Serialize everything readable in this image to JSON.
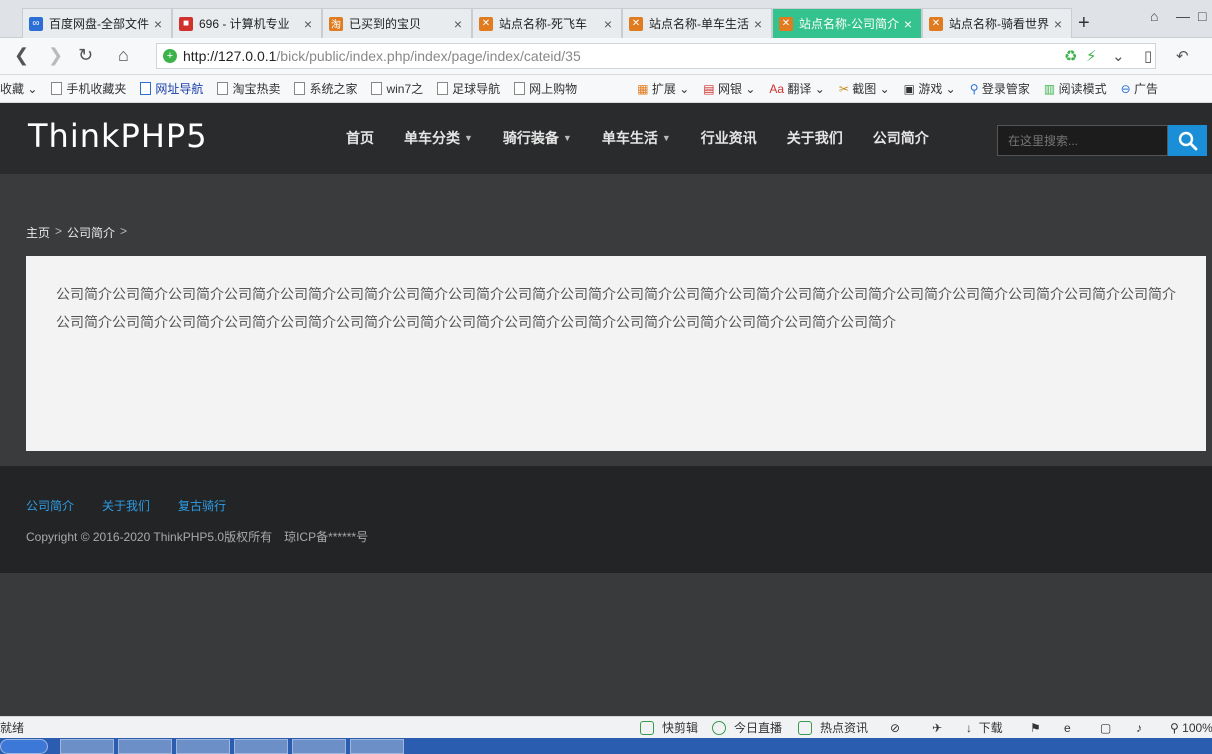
{
  "tabs": [
    {
      "title": "百度网盘-全部文件",
      "color": "#2b6fd6"
    },
    {
      "title": "696 - 计算机专业",
      "color": "#d0312d"
    },
    {
      "title": "已买到的宝贝",
      "color": "#e07b1f"
    },
    {
      "title": "站点名称-死飞车",
      "color": "#e07b1f"
    },
    {
      "title": "站点名称-单车生活",
      "color": "#e07b1f"
    },
    {
      "title": "站点名称-公司简介",
      "color": "#e07b1f",
      "active": true
    },
    {
      "title": "站点名称-骑看世界",
      "color": "#e07b1f"
    }
  ],
  "address": {
    "host": "http://127.0.0.1",
    "path": "/bick/public/index.php/index/page/index/cateid/35"
  },
  "bookmarks": {
    "b0": "收藏",
    "b1": "手机收藏夹",
    "b2": "网址导航",
    "b3": "淘宝热卖",
    "b4": "系统之家",
    "b5": "win7之",
    "b6": "足球导航",
    "b7": "网上购物",
    "b8": "扩展",
    "b9": "网银",
    "b10": "翻译",
    "b11": "截图",
    "b12": "游戏",
    "b13": "登录管家",
    "b14": "阅读模式",
    "b15": "广告"
  },
  "site": {
    "logo": "ThinkPHP5",
    "nav": [
      "首页",
      "单车分类",
      "骑行装备",
      "单车生活",
      "行业资讯",
      "关于我们",
      "公司简介"
    ],
    "search_placeholder": "在这里搜索..."
  },
  "breadcrumb": {
    "home": "主页",
    "sep": ">",
    "current": "公司简介",
    "trail": ">"
  },
  "content": {
    "text": "公司简介公司简介公司简介公司简介公司简介公司简介公司简介公司简介公司简介公司简介公司简介公司简介公司简介公司简介公司简介公司简介公司简介公司简介公司简介公司简介公司简介公司简介公司简介公司简介公司简介公司简介公司简介公司简介公司简介公司简介公司简介公司简介公司简介公司简介公司简介"
  },
  "footer": {
    "links": [
      "公司简介",
      "关于我们",
      "复古骑行"
    ],
    "copyright": "Copyright © 2016-2020 ThinkPHP5.0版权所有　琼ICP备******号"
  },
  "status": {
    "left": "就绪",
    "items": [
      "快剪辑",
      "今日直播",
      "热点资讯",
      "下载",
      "100%"
    ]
  }
}
